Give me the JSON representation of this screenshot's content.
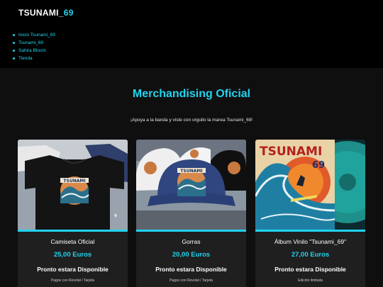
{
  "header": {
    "logo_main": "TSUNAMI_",
    "logo_accent": "69",
    "nav": [
      {
        "label": "Inicio Tsunami_69"
      },
      {
        "label": "Tsunami_69"
      },
      {
        "label": "Sahira Bloom"
      },
      {
        "label": "Tienda"
      }
    ]
  },
  "main": {
    "title": "Merchandising Oficial",
    "subtitle": "¡Apoya a la banda y viste con orgullo la marea Tsunami_69!"
  },
  "products": [
    {
      "name": "Camiseta Oficial",
      "price": "25,00 Euros",
      "status": "Pronto estara Disponible",
      "note": "Pagos con Revolut / Tarjeta"
    },
    {
      "name": "Gorras",
      "price": "20,00 Euros",
      "status": "Pronto estara Disponible",
      "note": "Pagos con Revolut / Tarjeta"
    },
    {
      "name": "Álbum Vinilo \"Tsunami_69\"",
      "price": "27,00 Euros",
      "status": "Pronto estara Disponible",
      "note": "Edición limitada",
      "artwork_text_main": "TSUNAMI",
      "artwork_text_num": "69"
    }
  ],
  "colors": {
    "accent": "#22d3ee",
    "header_bg": "#000000",
    "page_bg": "#0f0f0f",
    "card_bg": "#1f1f1f"
  },
  "icons": [
    "tshirt-photo",
    "cap-photo",
    "vinyl-album-photo"
  ]
}
